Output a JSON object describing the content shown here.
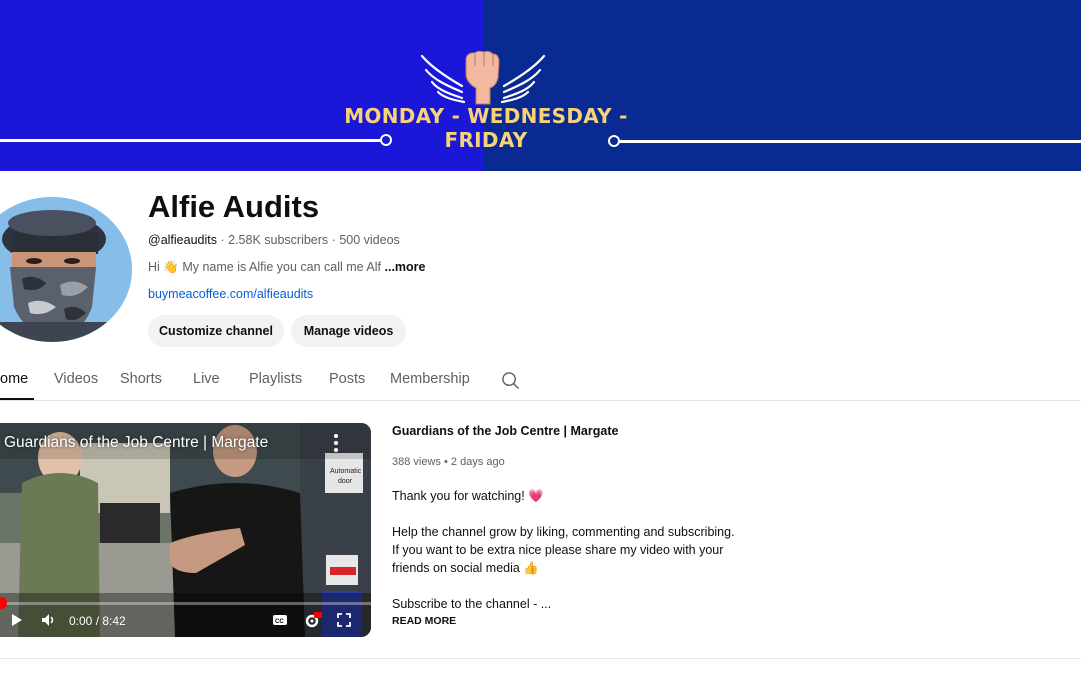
{
  "banner": {
    "schedule_text": "MONDAY - WEDNESDAY - FRIDAY",
    "colors": {
      "left": "#1a17d8",
      "right": "#0a2a93",
      "text": "#f7d376"
    },
    "logo_icon": "winged-fist-icon"
  },
  "channel": {
    "name": "Alfie Audits",
    "handle": "@alfieaudits",
    "subscribers": "2.58K subscribers",
    "video_count": "500 videos",
    "separator": "·",
    "description": "Hi 👋 My name is Alfie you can call me Alf",
    "more_label": "...more",
    "link": "buymeacoffee.com/alfieaudits",
    "buttons": {
      "customize": "Customize channel",
      "manage": "Manage videos"
    }
  },
  "tabs": [
    {
      "label": "Home",
      "visible_label": "ome",
      "active": true
    },
    {
      "label": "Videos",
      "active": false
    },
    {
      "label": "Shorts",
      "active": false
    },
    {
      "label": "Live",
      "active": false
    },
    {
      "label": "Playlists",
      "active": false
    },
    {
      "label": "Posts",
      "active": false
    },
    {
      "label": "Membership",
      "active": false
    }
  ],
  "featured_video": {
    "player_title": "Guardians of the Job Centre | Margate",
    "time": "0:00 / 8:42",
    "progress": 0,
    "title": "Guardians of the Job Centre | Margate",
    "views": "388 views",
    "age": "2 days ago",
    "description_lines": [
      "Thank you for watching! 💗",
      "",
      "Help the channel grow by liking, commenting and subscribing.",
      "If you want to be extra nice please share my video with your",
      "friends on social media 👍",
      "",
      "Subscribe to the channel -  ..."
    ],
    "read_more": "READ MORE"
  }
}
